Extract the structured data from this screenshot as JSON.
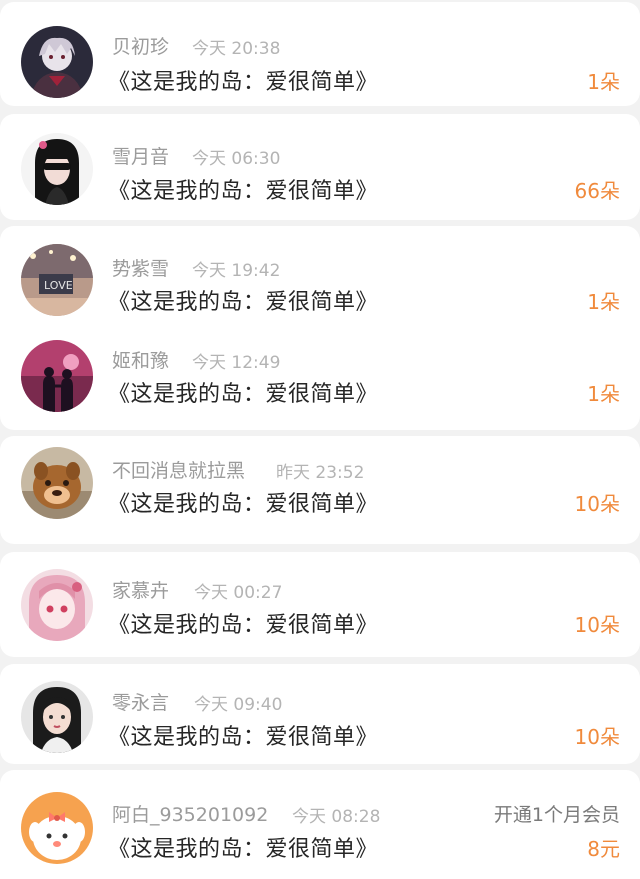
{
  "gifts": [
    {
      "name": "贝初珍",
      "time": "今天 20:38",
      "title": "《这是我的岛：爱很简单》",
      "amount": "1朵"
    },
    {
      "name": "雪月音",
      "time": "今天 06:30",
      "title": "《这是我的岛：爱很简单》",
      "amount": "66朵"
    },
    {
      "name": "势紫雪",
      "time": "今天 19:42",
      "title": "《这是我的岛：爱很简单》",
      "amount": "1朵"
    },
    {
      "name": "姬和豫",
      "time": "今天 12:49",
      "title": "《这是我的岛：爱很简单》",
      "amount": "1朵"
    },
    {
      "name": "不回消息就拉黑",
      "time": "昨天 23:52",
      "title": "《这是我的岛：爱很简单》",
      "amount": "10朵"
    },
    {
      "name": "家慕卉",
      "time": "今天 00:27",
      "title": "《这是我的岛：爱很简单》",
      "amount": "10朵"
    },
    {
      "name": "零永言",
      "time": "今天 09:40",
      "title": "《这是我的岛：爱很简单》",
      "amount": "10朵"
    },
    {
      "name": "阿白_935201092",
      "time": "今天 08:28",
      "title": "《这是我的岛：爱很简单》",
      "amount": "8元",
      "note": "开通1个月会员"
    }
  ]
}
